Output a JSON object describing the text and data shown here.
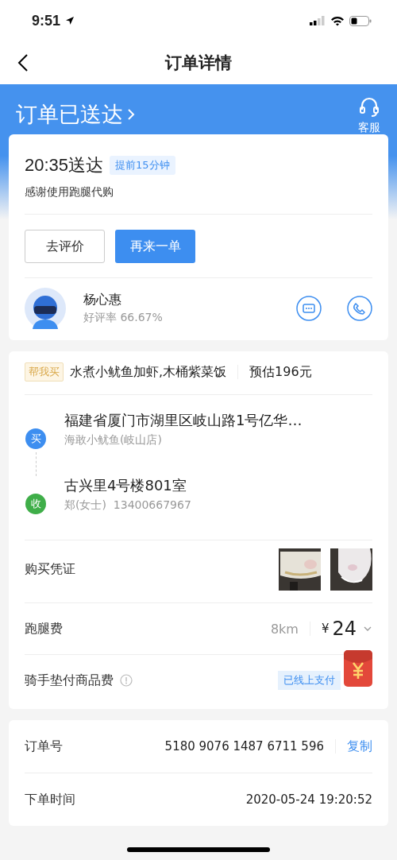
{
  "status_bar": {
    "time": "9:51"
  },
  "nav": {
    "title": "订单详情"
  },
  "header": {
    "status": "订单已送达",
    "service_label": "客服"
  },
  "delivery": {
    "time": "20:35送达",
    "badge": "提前15分钟",
    "note": "感谢使用跑腿代购",
    "buttons": [
      {
        "label": "去评价",
        "kind": "outline"
      },
      {
        "label": "再来一单",
        "kind": "primary"
      }
    ],
    "rider": {
      "name": "杨心惠",
      "rating": "好评率 66.67%"
    }
  },
  "order": {
    "tag": "帮我买",
    "items": "水煮小鱿鱼加虾,木桶紫菜饭",
    "estimate": "预估196元",
    "stops": [
      {
        "marker": "买",
        "color": "#3d8ef0",
        "address": "福建省厦门市湖里区岐山路1号亿华…",
        "detail": "海敢小鱿鱼(岐山店)"
      },
      {
        "marker": "收",
        "color": "#3fae49",
        "address": "古兴里4号楼801室",
        "detail": "郑(女士)  13400667967"
      }
    ],
    "proof_label": "购买凭证",
    "fee": {
      "label": "跑腿费",
      "distance": "8km",
      "currency": "¥",
      "amount": "24"
    },
    "goods_fee": {
      "label": "骑手垫付商品费",
      "badge": "已线上支付"
    }
  },
  "info": {
    "rows": [
      {
        "label": "订单号",
        "value": "5180 9076 1487 6711 596",
        "action": "复制"
      },
      {
        "label": "下单时间",
        "value": "2020-05-24 19:20:52"
      }
    ]
  }
}
